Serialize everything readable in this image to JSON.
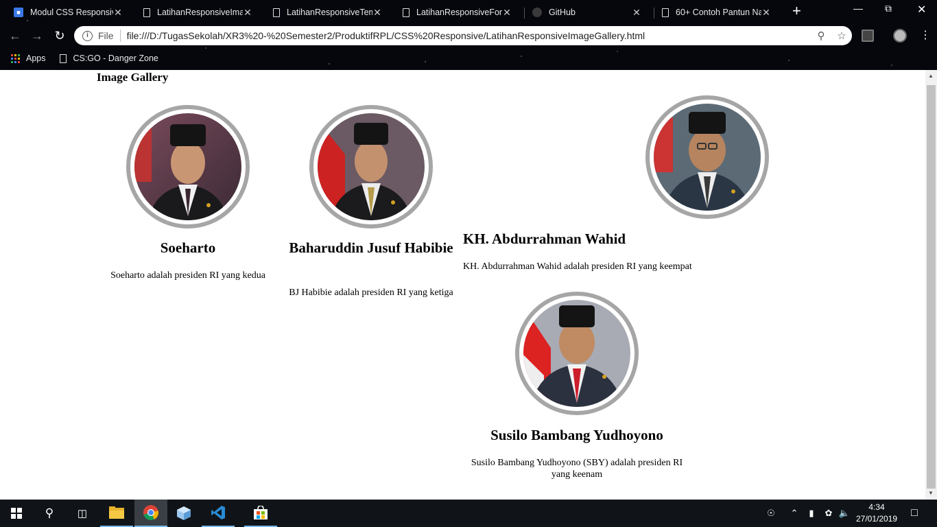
{
  "browser": {
    "tabs": [
      {
        "title": "Modul CSS Responsive",
        "favicon": "modul-icon"
      },
      {
        "title": "LatihanResponsiveImag",
        "favicon": "page-icon"
      },
      {
        "title": "LatihanResponsiveTemp",
        "favicon": "page-icon"
      },
      {
        "title": "LatihanResponsiveForm",
        "favicon": "page-icon"
      },
      {
        "title": "GitHub",
        "favicon": "github-icon"
      },
      {
        "title": "60+ Contoh Pantun Na",
        "favicon": "page-icon"
      }
    ],
    "address": {
      "scheme_label": "File",
      "url": "file:///D:/TugasSekolah/XR3%20-%20Semester2/ProduktifRPL/CSS%20Responsive/LatihanResponsiveImageGallery.html"
    },
    "bookmarks": [
      {
        "label": "Apps"
      },
      {
        "label": "CS:GO - Danger Zone"
      }
    ]
  },
  "page": {
    "title": "Image Gallery",
    "gallery": [
      {
        "name": "Soeharto",
        "desc": "Soeharto adalah presiden RI yang kedua"
      },
      {
        "name": "Baharuddin Jusuf Habibie",
        "desc": "BJ Habibie adalah presiden RI yang ketiga"
      },
      {
        "name": "KH. Abdurrahman Wahid",
        "desc": "KH. Abdurrahman Wahid adalah presiden RI yang keempat"
      },
      {
        "name": "Susilo Bambang Yudhoyono",
        "desc": "Susilo Bambang Yudhoyono (SBY) adalah presiden RI yang keenam"
      }
    ]
  },
  "taskbar": {
    "time": "4:34",
    "date": "27/01/2019"
  },
  "colors": {
    "portrait_border": "#a6a6a6",
    "taskbar_bg": "#101418",
    "accent": "#76b9ed"
  }
}
